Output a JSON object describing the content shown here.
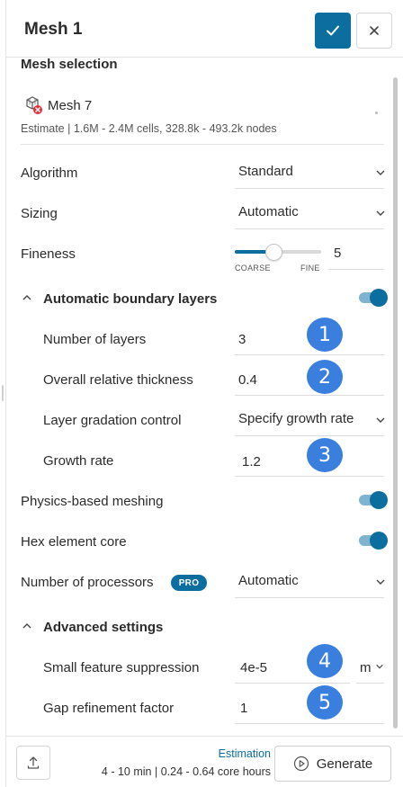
{
  "header": {
    "title": "Mesh 1",
    "confirm_icon": "check-icon",
    "close_icon": "close-icon"
  },
  "mesh_selection": {
    "title": "Mesh selection",
    "mesh_name": "Mesh 7",
    "mesh_icon": "mesh-error-icon",
    "estimate": "Estimate | 1.6M - 2.4M cells, 328.8k - 493.2k nodes"
  },
  "fields": {
    "algorithm": {
      "label": "Algorithm",
      "value": "Standard"
    },
    "sizing": {
      "label": "Sizing",
      "value": "Automatic"
    },
    "fineness": {
      "label": "Fineness",
      "value": "5",
      "min_label": "COARSE",
      "max_label": "FINE",
      "level_fraction": 0.45
    },
    "boundary_layers": {
      "label": "Automatic boundary layers",
      "enabled": true
    },
    "num_layers": {
      "label": "Number of layers",
      "value": "3",
      "badge": "1"
    },
    "rel_thickness": {
      "label": "Overall relative thickness",
      "value": "0.4",
      "badge": "2"
    },
    "gradation": {
      "label": "Layer gradation control",
      "value": "Specify growth rate"
    },
    "growth_rate": {
      "label": "Growth rate",
      "value": "1.2",
      "badge": "3"
    },
    "physics_meshing": {
      "label": "Physics-based meshing",
      "enabled": true
    },
    "hex_core": {
      "label": "Hex element core",
      "enabled": true
    },
    "processors": {
      "label": "Number of processors",
      "badge": "PRO",
      "value": "Automatic"
    },
    "advanced": {
      "label": "Advanced settings"
    },
    "small_feature": {
      "label": "Small feature suppression",
      "value": "4e-5",
      "unit": "m",
      "badge": "4"
    },
    "gap_refinement": {
      "label": "Gap refinement factor",
      "value": "1",
      "badge": "5"
    }
  },
  "footer": {
    "estimation_title": "Estimation",
    "estimation_detail": "4 - 10 min | 0.24 - 0.64 core hours",
    "generate_label": "Generate",
    "upload_icon": "upload-icon",
    "generate_icon": "play-circle-icon"
  },
  "colors": {
    "accent": "#0b6e9f",
    "badge": "#3b7fde",
    "toggle_track": "#7fb3d0"
  }
}
